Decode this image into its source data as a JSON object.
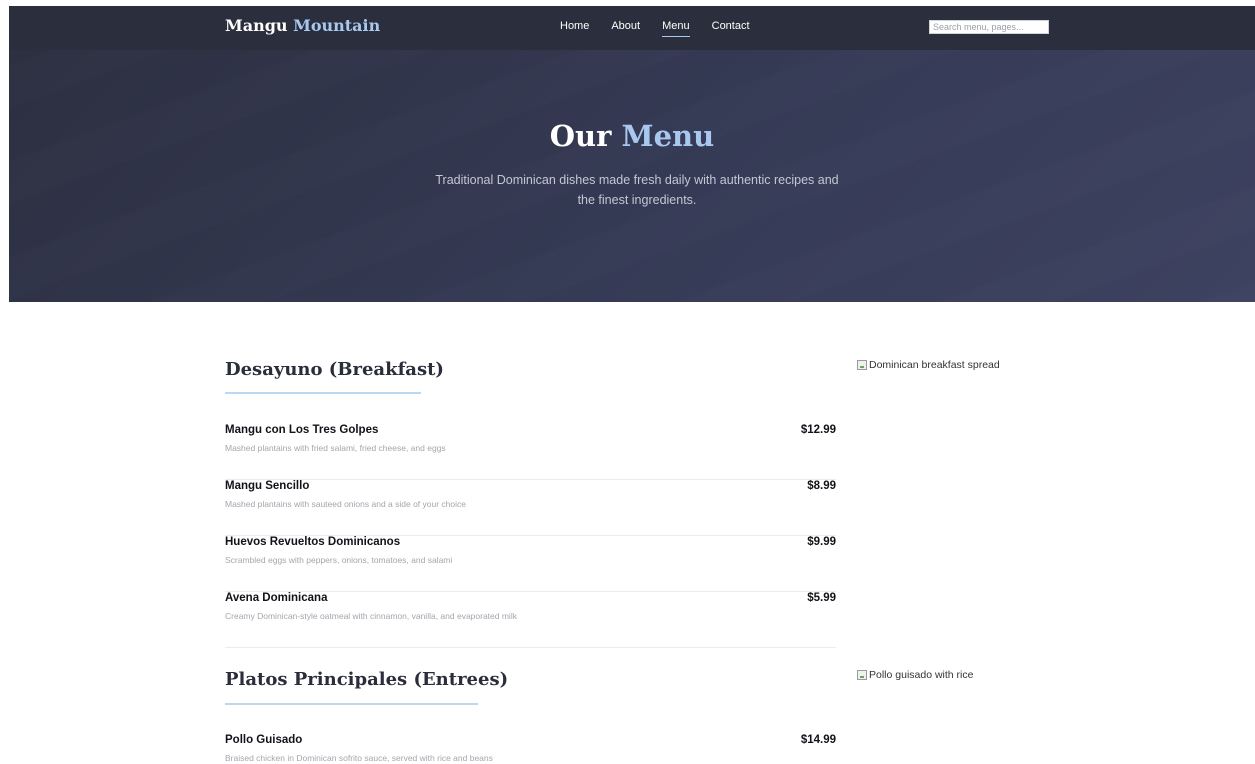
{
  "nav": {
    "brand_main": "Mangu",
    "brand_accent": "Mountain",
    "links": [
      "Home",
      "About",
      "Menu",
      "Contact"
    ],
    "active_link": "Menu",
    "search_placeholder": "Search menu, pages..."
  },
  "hero": {
    "title_main": "Our",
    "title_accent": "Menu",
    "subtitle": "Traditional Dominican dishes made fresh daily with authentic recipes and the finest ingredients."
  },
  "sections": [
    {
      "title": "Desayuno (Breakfast)",
      "image_alt": "Dominican breakfast spread",
      "items": [
        {
          "name": "Mangu con Los Tres Golpes",
          "desc": "Mashed plantains with fried salami, fried cheese, and eggs",
          "price": "$12.99"
        },
        {
          "name": "Mangu Sencillo",
          "desc": "Mashed plantains with sauteed onions and a side of your choice",
          "price": "$8.99"
        },
        {
          "name": "Huevos Revueltos Dominicanos",
          "desc": "Scrambled eggs with peppers, onions, tomatoes, and salami",
          "price": "$9.99"
        },
        {
          "name": "Avena Dominicana",
          "desc": "Creamy Dominican-style oatmeal with cinnamon, vanilla, and evaporated milk",
          "price": "$5.99"
        }
      ]
    },
    {
      "title": "Platos Principales (Entrees)",
      "image_alt": "Pollo guisado with rice",
      "items": [
        {
          "name": "Pollo Guisado",
          "desc": "Braised chicken in Dominican sofrito sauce, served with rice and beans",
          "price": "$14.99"
        }
      ]
    }
  ],
  "colors": {
    "accent": "#a9c8ef",
    "nav_bg": "#2b2e3c",
    "hero_bg": "#353a55",
    "rule": "#bcd8f0"
  },
  "icons": {
    "broken_image": "broken-image-icon"
  }
}
